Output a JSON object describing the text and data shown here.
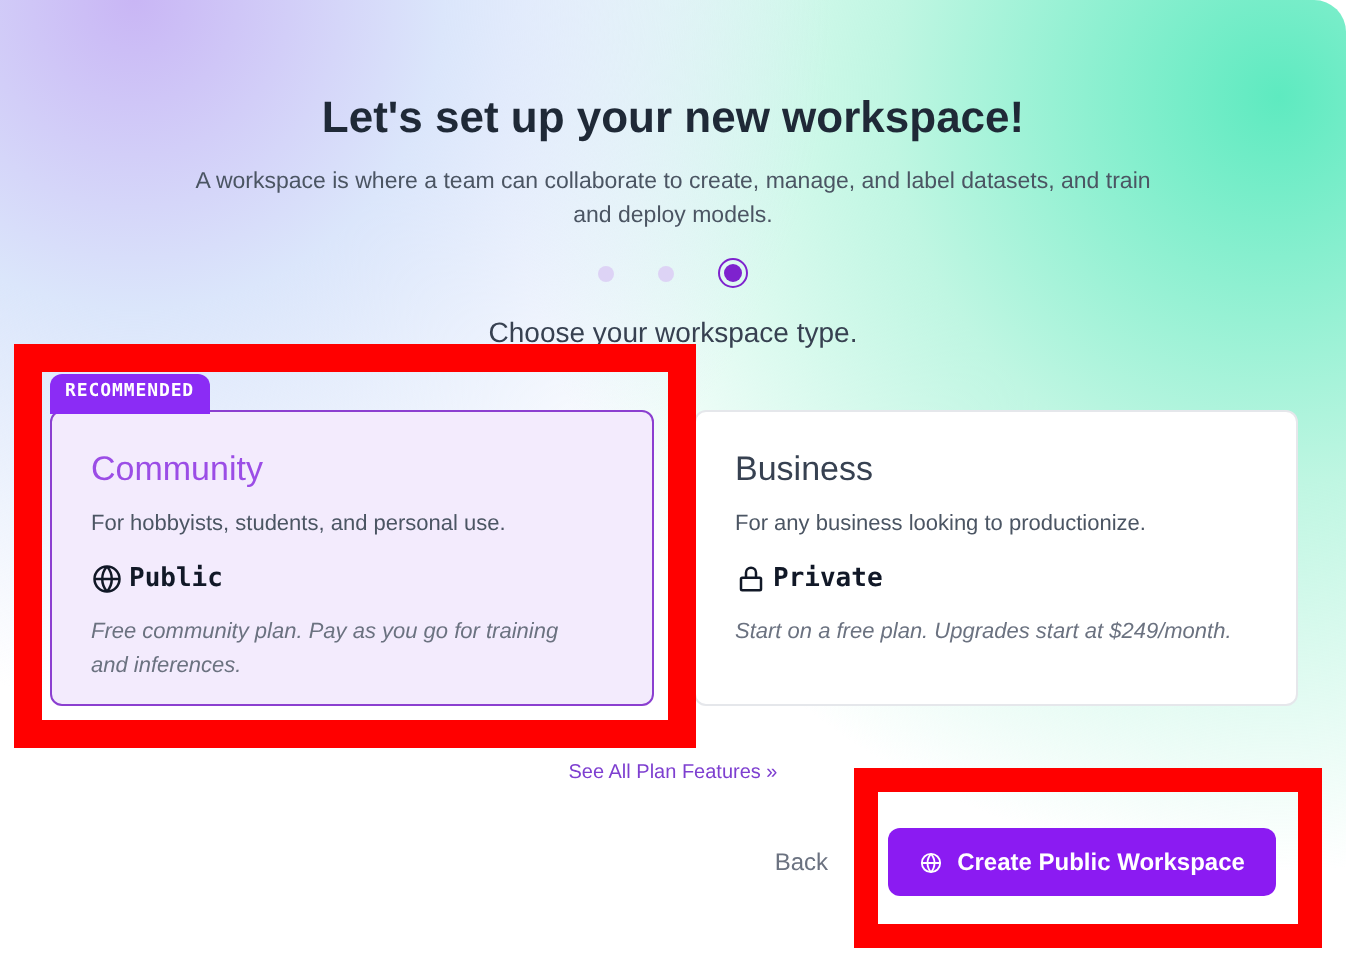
{
  "title": "Let's set up your new workspace!",
  "subtitle": "A workspace is where a team can collaborate to create, manage, and label datasets, and train and deploy models.",
  "steps": [
    {
      "selected": false
    },
    {
      "selected": false
    },
    {
      "selected": true
    }
  ],
  "prompt": "Choose your workspace type.",
  "plans": [
    {
      "name": "Community",
      "badge": "RECOMMENDED",
      "description": "For hobbyists, students, and personal use.",
      "visibility": {
        "kind": "public",
        "label": "Public"
      },
      "note": "Free community plan. Pay as you go for training and inferences.",
      "selected": true,
      "highlighted": true
    },
    {
      "name": "Business",
      "description": "For any business looking to productionize.",
      "visibility": {
        "kind": "private",
        "label": "Private"
      },
      "note": "Start on a free plan. Upgrades start at $249/month.",
      "selected": false,
      "highlighted": false
    }
  ],
  "features_link": "See All Plan Features »",
  "back_button": "Back",
  "create_button": {
    "label": "Create Public Workspace",
    "highlighted": true
  }
}
